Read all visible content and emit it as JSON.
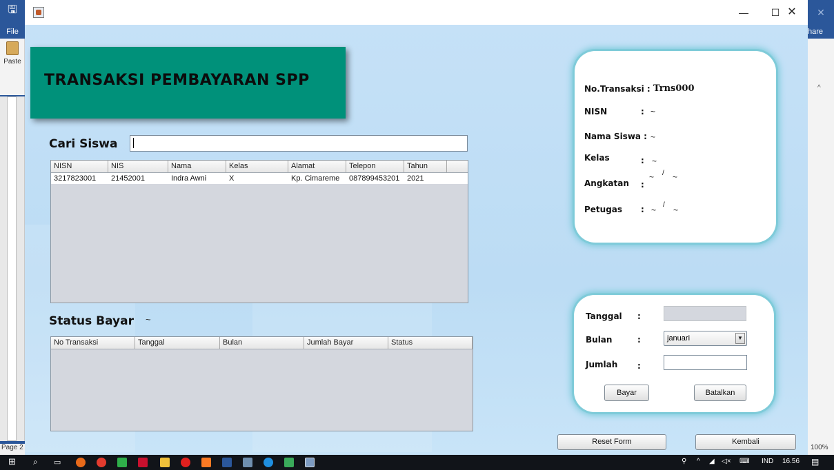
{
  "word": {
    "file_tab": "File",
    "paste_label": "Paste",
    "page_label": "Page 2",
    "share_label": "hare",
    "zoom": "100%"
  },
  "window": {
    "minimize": "—",
    "maximize": "☐",
    "close": "✕"
  },
  "banner": {
    "title": "TRANSAKSI PEMBAYARAN SPP"
  },
  "search": {
    "label": "Cari Siswa",
    "value": ""
  },
  "siswa_table": {
    "columns": [
      "NISN",
      "NIS",
      "Nama",
      "Kelas",
      "Alamat",
      "Telepon",
      "Tahun"
    ],
    "rows": [
      [
        "3217823001",
        "21452001",
        "Indra Awni",
        "X",
        "Kp. Cimareme",
        "087899453201",
        "2021"
      ]
    ]
  },
  "status": {
    "label": "Status Bayar",
    "value": "~"
  },
  "bayar_table": {
    "columns": [
      "No Transaksi",
      "Tanggal",
      "Bulan",
      "Jumlah Bayar",
      "Status"
    ]
  },
  "info": {
    "no_transaksi_label": "No.Transaksi :",
    "no_transaksi_value": "Trns000",
    "nisn_label": "NISN",
    "nisn_colon": ":",
    "nisn_value": "~",
    "nama_label": "Nama Siswa :",
    "nama_value": "~",
    "kelas_label": "Kelas",
    "kelas_colon": ":",
    "kelas_value": "~",
    "angkatan_label": "Angkatan",
    "angkatan_colon": ":",
    "angkatan_value_a": "~",
    "angkatan_sep": "/",
    "angkatan_value_b": "~",
    "petugas_label": "Petugas",
    "petugas_colon": ":",
    "petugas_value_a": "~",
    "petugas_sep": "/",
    "petugas_value_b": "~"
  },
  "form": {
    "tanggal_label": "Tanggal",
    "bulan_label": "Bulan",
    "jumlah_label": "Jumlah",
    "colon": ":",
    "tanggal_value": "",
    "bulan_selected": "januari",
    "jumlah_value": "",
    "bayar_button": "Bayar",
    "batalkan_button": "Batalkan"
  },
  "footer": {
    "reset_button": "Reset Form",
    "kembali_button": "Kembali"
  },
  "taskbar": {
    "language": "IND",
    "time": "16.56"
  },
  "colors": {
    "banner": "#00917a",
    "window_bg": "#c3dff5",
    "card_glow": "#6fc7d6",
    "word_blue": "#2b579a"
  }
}
